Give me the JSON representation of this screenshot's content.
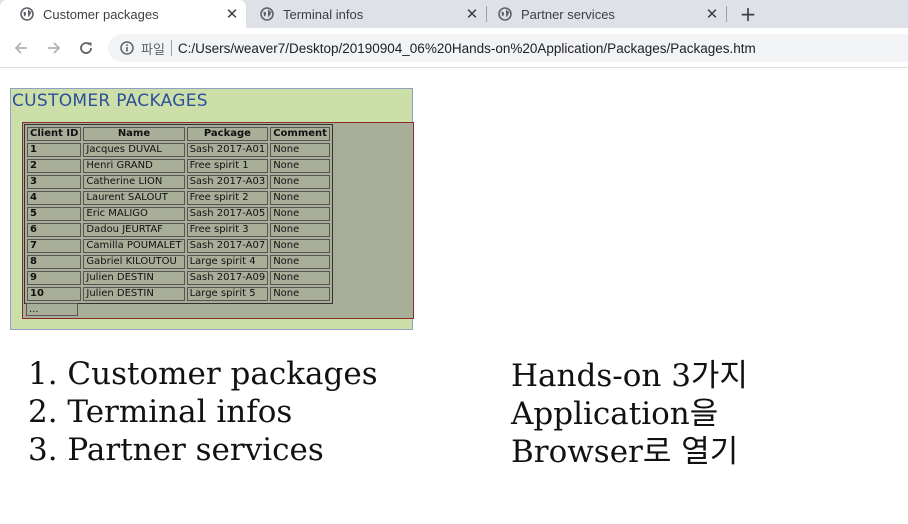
{
  "browser": {
    "tabs": [
      {
        "title": "Customer packages",
        "active": true
      },
      {
        "title": "Terminal infos",
        "active": false
      },
      {
        "title": "Partner services",
        "active": false
      }
    ],
    "close_glyph": "✕",
    "new_tab_glyph": "+",
    "address": {
      "scheme_label": "파일",
      "url": "C:/Users/weaver7/Desktop/20190904_06%20Hands-on%20Application/Packages/Packages.htm"
    }
  },
  "app": {
    "title": "CUSTOMER PACKAGES",
    "columns": [
      "Client ID",
      "Name",
      "Package",
      "Comment"
    ],
    "rows": [
      [
        "1",
        "Jacques DUVAL",
        "Sash 2017-A01",
        "None"
      ],
      [
        "2",
        "Henri GRAND",
        "Free spirit 1",
        "None"
      ],
      [
        "3",
        "Catherine LION",
        "Sash 2017-A03",
        "None"
      ],
      [
        "4",
        "Laurent SALOUT",
        "Free spirit 2",
        "None"
      ],
      [
        "5",
        "Eric MALIGO",
        "Sash 2017-A05",
        "None"
      ],
      [
        "6",
        "Dadou JEURTAF",
        "Free spirit 3",
        "None"
      ],
      [
        "7",
        "Camilla POUMALET",
        "Sash 2017-A07",
        "None"
      ],
      [
        "8",
        "Gabriel KILOUTOU",
        "Large spirit 4",
        "None"
      ],
      [
        "9",
        "Julien DESTIN",
        "Sash 2017-A09",
        "None"
      ],
      [
        "10",
        "Julien DESTIN",
        "Large spirit 5",
        "None"
      ]
    ],
    "more": "..."
  },
  "notes": {
    "left": [
      "1. Customer packages",
      "2. Terminal infos",
      "3. Partner services"
    ],
    "right": [
      "Hands-on 3가지",
      "Application을",
      "Browser로 열기"
    ]
  },
  "colors": {
    "panel_bg": "#cddfa9",
    "title_color": "#2b4f9a",
    "grid_bg": "#a9ae99",
    "grid_border": "#8b2a2a"
  }
}
